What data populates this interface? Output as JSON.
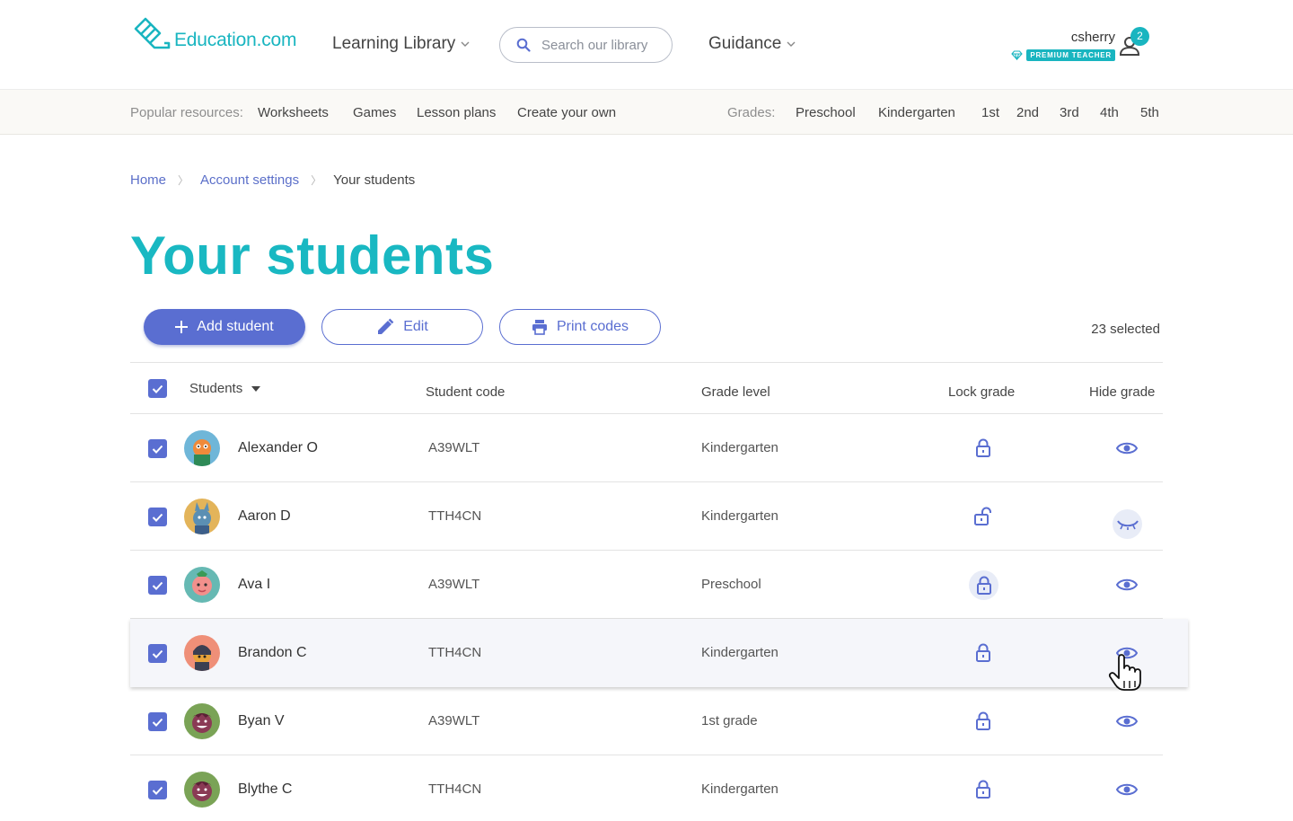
{
  "brand": {
    "name": "Education.com",
    "accent": "#19b5c0",
    "primary": "#5a6ed1"
  },
  "header": {
    "nav": [
      {
        "label": "Learning Library"
      },
      {
        "label": "Guidance"
      }
    ],
    "search_placeholder": "Search our library",
    "user": {
      "name": "csherry",
      "badge": "PREMIUM TEACHER",
      "notifications": "2"
    }
  },
  "subbar": {
    "popular_label": "Popular resources:",
    "popular": [
      "Worksheets",
      "Games",
      "Lesson plans",
      "Create your own"
    ],
    "grades_label": "Grades:",
    "grades": [
      "Preschool",
      "Kindergarten",
      "1st",
      "2nd",
      "3rd",
      "4th",
      "5th"
    ]
  },
  "breadcrumb": {
    "home": "Home",
    "account": "Account settings",
    "current": "Your students"
  },
  "page_title": "Your students",
  "toolbar": {
    "add_label": "Add student",
    "edit_label": "Edit",
    "print_label": "Print codes",
    "selected": "23 selected"
  },
  "table": {
    "headers": {
      "students": "Students",
      "code": "Student code",
      "grade": "Grade level",
      "lock": "Lock grade",
      "hide": "Hide grade"
    },
    "rows": [
      {
        "name": "Alexander O",
        "code": "A39WLT",
        "grade": "Kindergarten",
        "locked": true,
        "visible": true
      },
      {
        "name": "Aaron D",
        "code": "TTH4CN",
        "grade": "Kindergarten",
        "locked": false,
        "visible": false
      },
      {
        "name": "Ava I",
        "code": "A39WLT",
        "grade": "Preschool",
        "locked": true,
        "visible": true
      },
      {
        "name": "Brandon C",
        "code": "TTH4CN",
        "grade": "Kindergarten",
        "locked": true,
        "visible": true
      },
      {
        "name": "Byan V",
        "code": "A39WLT",
        "grade": "1st grade",
        "locked": true,
        "visible": true
      },
      {
        "name": "Blythe C",
        "code": "TTH4CN",
        "grade": "Kindergarten",
        "locked": true,
        "visible": true
      }
    ]
  }
}
